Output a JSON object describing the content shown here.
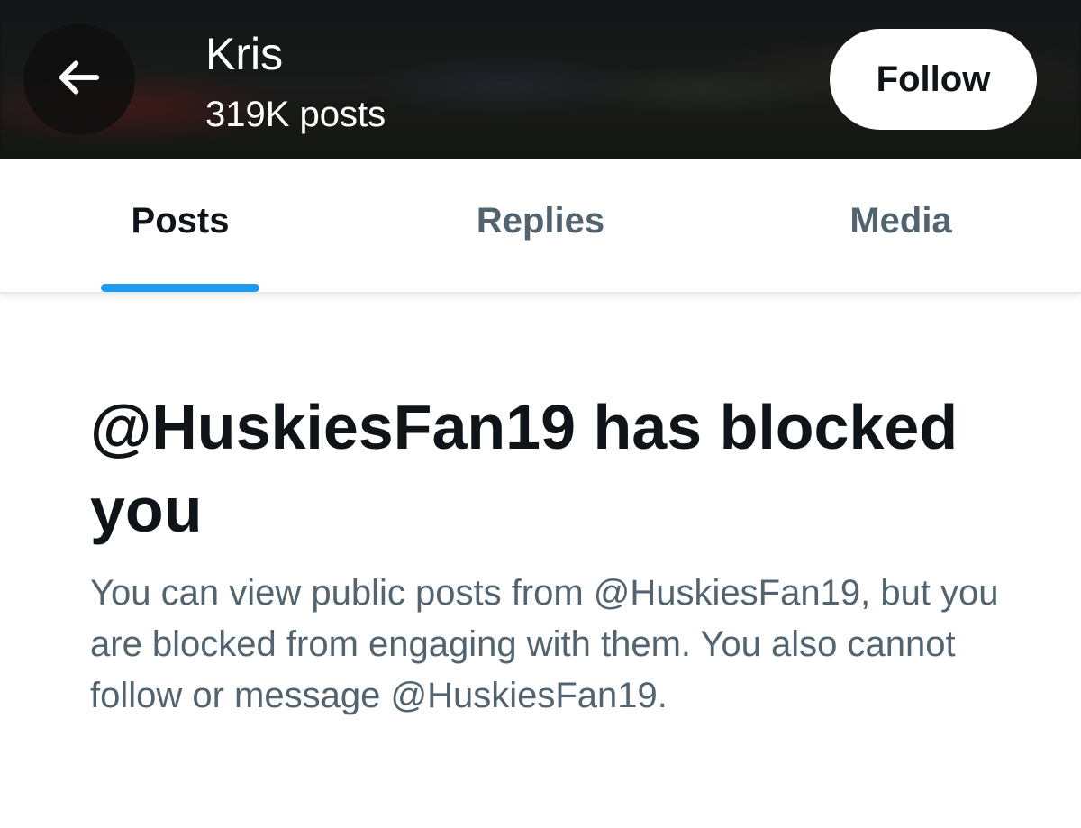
{
  "header": {
    "back_icon": "arrow-left-icon",
    "name": "Kris",
    "post_count": "319K posts",
    "follow_label": "Follow"
  },
  "tabs": [
    {
      "label": "Posts",
      "active": true
    },
    {
      "label": "Replies",
      "active": false
    },
    {
      "label": "Media",
      "active": false
    }
  ],
  "blocked": {
    "title": "@HuskiesFan19 has blocked you",
    "description": "You can view public posts from @HuskiesFan19, but you are blocked from engaging with them. You also cannot follow or message @HuskiesFan19."
  },
  "colors": {
    "accent": "#1d9bf0",
    "text_primary": "#0f1419",
    "text_secondary": "#536471"
  }
}
